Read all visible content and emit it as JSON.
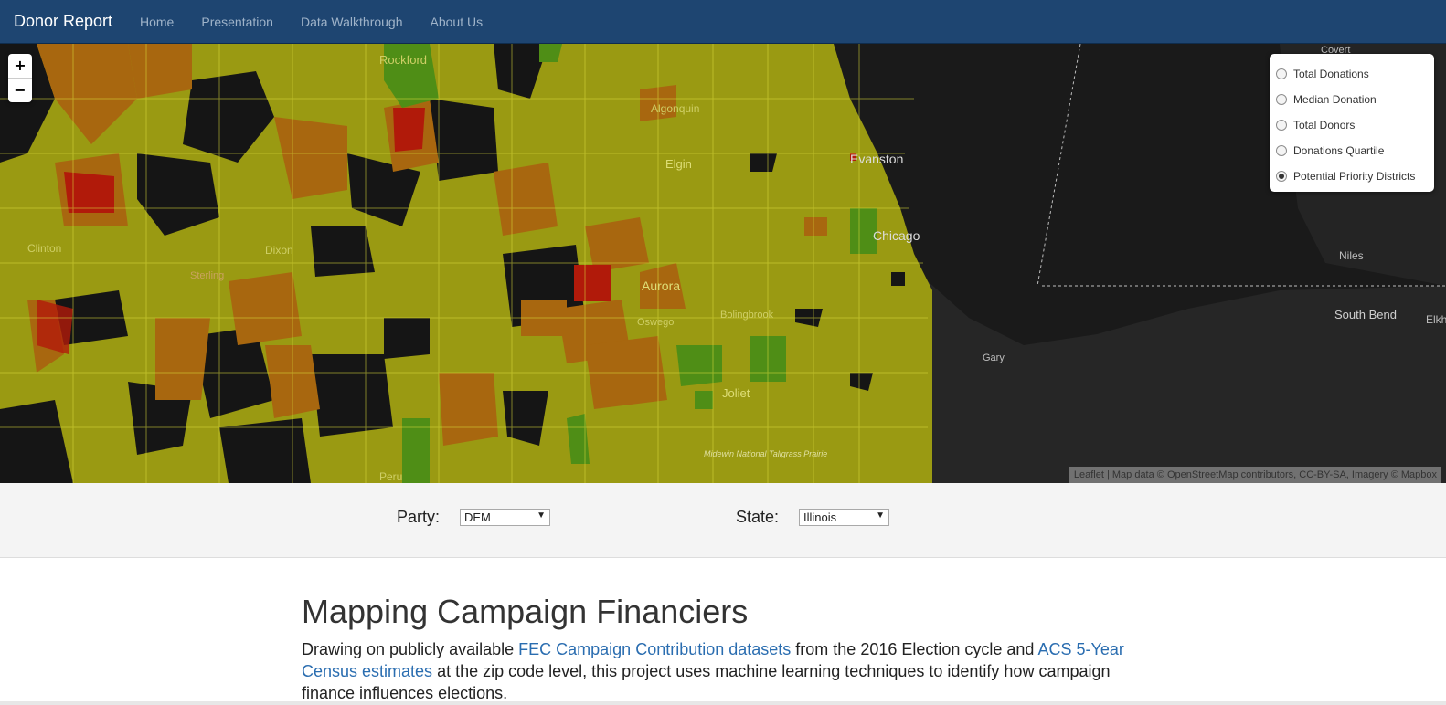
{
  "navbar": {
    "brand": "Donor Report",
    "links": [
      "Home",
      "Presentation",
      "Data Walkthrough",
      "About Us"
    ]
  },
  "map": {
    "zoom_in": "+",
    "zoom_out": "−",
    "labels": [
      "Rockford",
      "Algonquin",
      "Elgin",
      "Evanston",
      "Chicago",
      "Clinton",
      "Dixon",
      "Sterling",
      "Aurora",
      "Oswego",
      "Bolingbrook",
      "Joliet",
      "Gary",
      "Niles",
      "South Bend",
      "Covert",
      "Midewin National Tallgrass Prairie",
      "Peru",
      "Elkh"
    ],
    "layers": [
      {
        "label": "Total Donations",
        "checked": false
      },
      {
        "label": "Median Donation",
        "checked": false
      },
      {
        "label": "Total Donors",
        "checked": false
      },
      {
        "label": "Donations Quartile",
        "checked": false
      },
      {
        "label": "Potential Priority Districts",
        "checked": true
      }
    ],
    "attribution": "Leaflet | Map data © OpenStreetMap contributors, CC-BY-SA, Imagery © Mapbox"
  },
  "controls": {
    "party_label": "Party:",
    "party_value": "DEM",
    "state_label": "State:",
    "state_value": "Illinois"
  },
  "content": {
    "title": "Mapping Campaign Financiers",
    "intro_1": "Drawing on publicly available ",
    "link_fec": "FEC Campaign Contribution datasets",
    "intro_2": " from the 2016 Election cycle and ",
    "link_acs": "ACS 5-Year Census estimates",
    "intro_3": " at the zip code level, this project uses machine learning techniques to identify how campaign finance influences elections."
  },
  "colors": {
    "navbar": "#1e4571",
    "olive": "#9a9a12",
    "orange": "#a8670f",
    "red": "#b11a0a",
    "green": "#4f8e16",
    "water": "#1a1a1a"
  }
}
